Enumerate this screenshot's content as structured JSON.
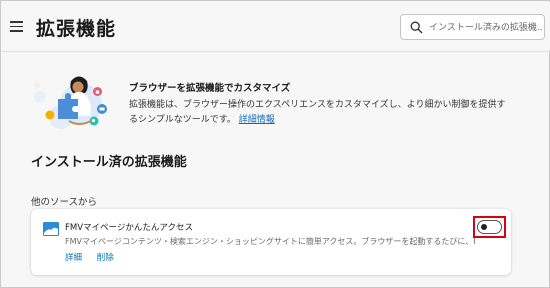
{
  "header": {
    "title": "拡張機能",
    "search_placeholder": "インストール済みの拡張機..."
  },
  "banner": {
    "title": "ブラウザーを拡張機能でカスタマイズ",
    "description": "拡張機能は、ブラウザー操作のエクスペリエンスをカスタマイズし、より細かい制御を提供するシンプルなツールです。",
    "link_label": "詳細情報"
  },
  "installed": {
    "heading": "インストール済の拡張機能",
    "source_heading": "他のソースから",
    "extensions": [
      {
        "name": "FMVマイページかんたんアクセス",
        "description": "FMVマイページコンテンツ・検索エンジン・ショッピングサイトに簡単アクセス。ブラウザーを起動するたびに、FMVマイページコンテ...",
        "details_label": "詳細",
        "remove_label": "削除",
        "enabled": false
      }
    ]
  },
  "colors": {
    "accent": "#0f6cbd",
    "highlight": "#d0021b"
  }
}
